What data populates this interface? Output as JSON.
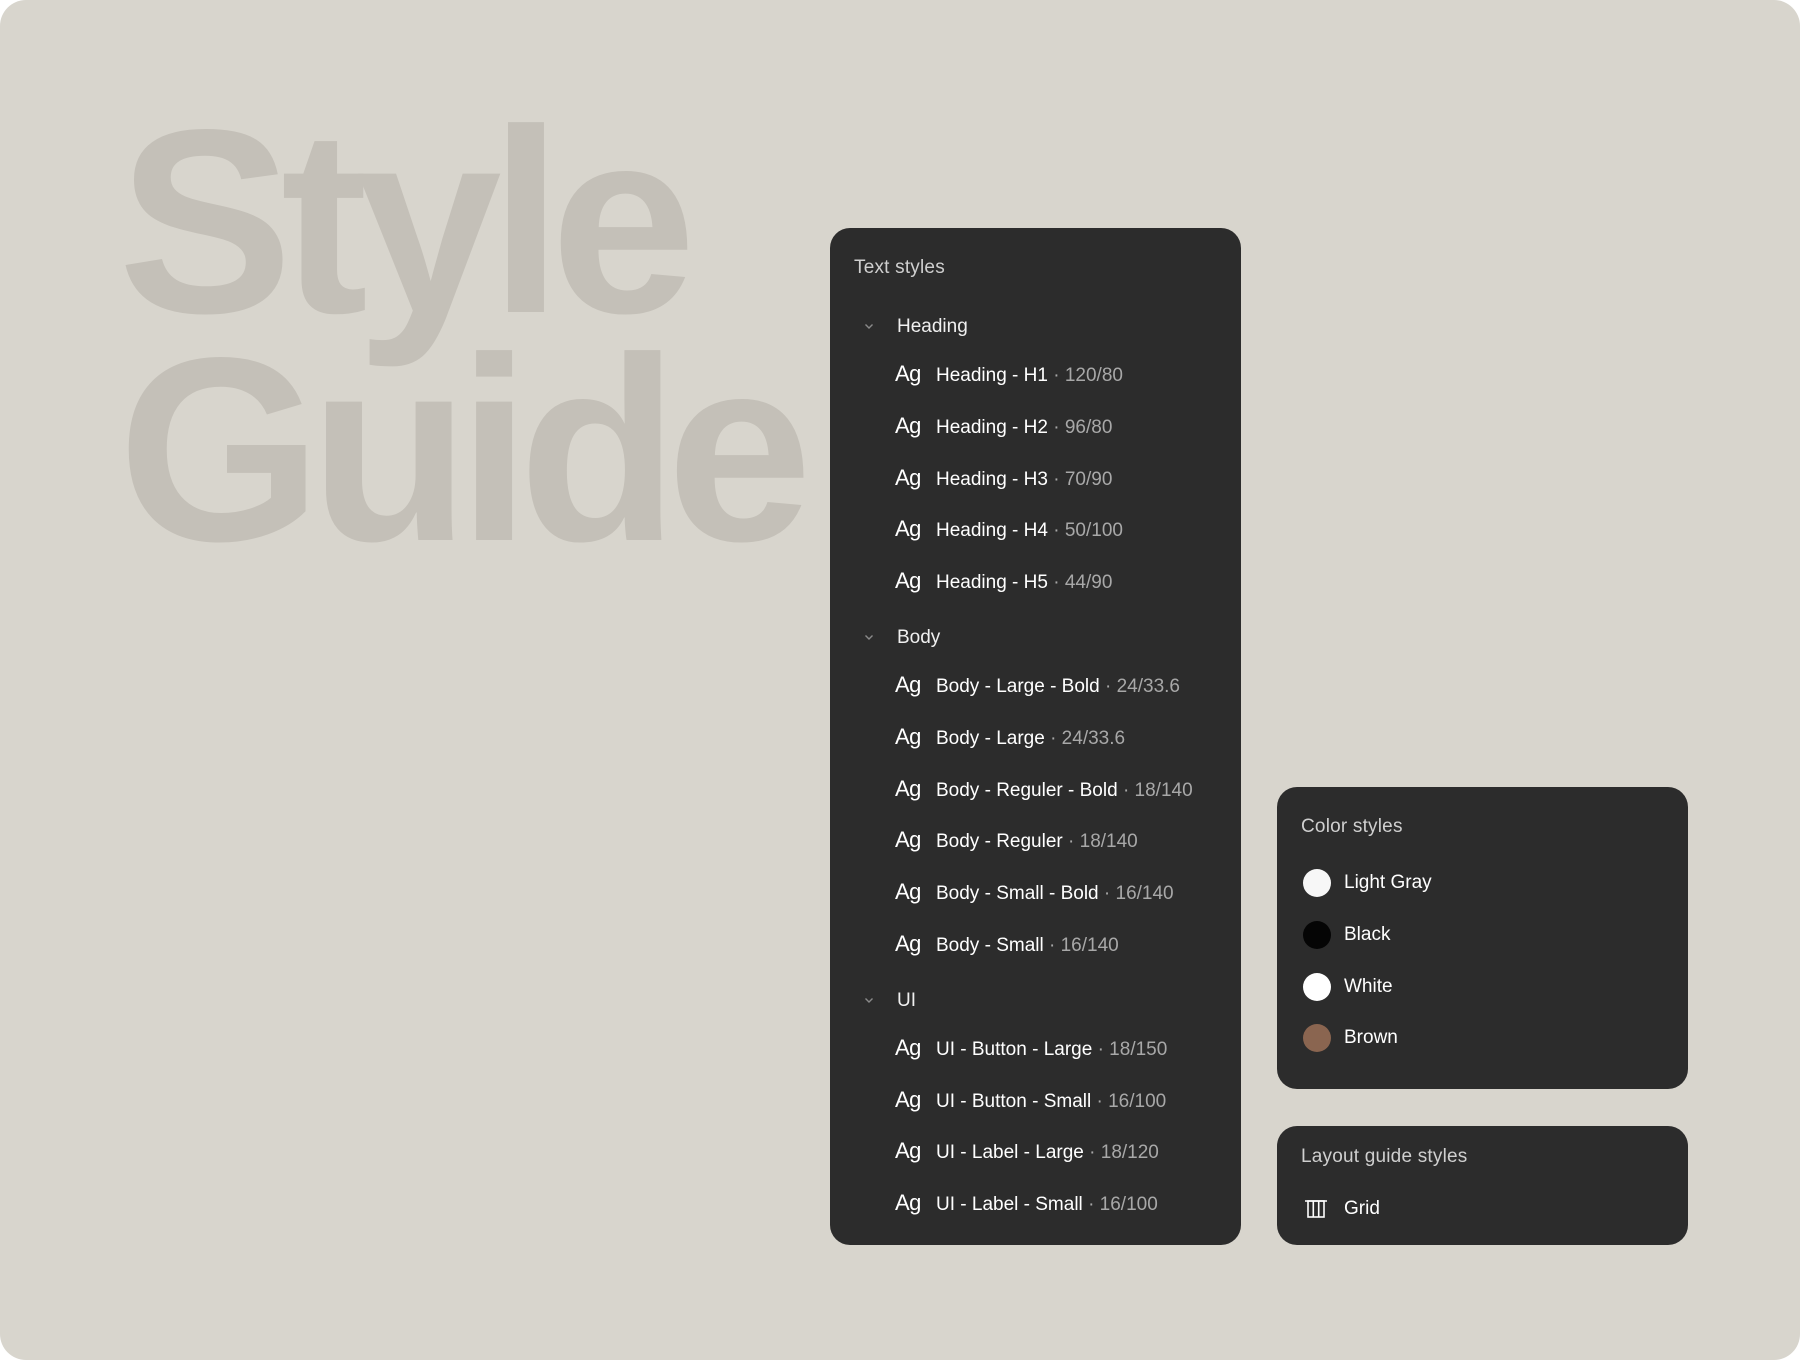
{
  "hero": {
    "line1": "Style",
    "line2": "Guide"
  },
  "text_styles": {
    "title": "Text styles",
    "groups": [
      {
        "label": "Heading",
        "styles": [
          {
            "ag": "Ag",
            "name": "Heading - H1",
            "meta": "· 120/80"
          },
          {
            "ag": "Ag",
            "name": "Heading - H2",
            "meta": "· 96/80"
          },
          {
            "ag": "Ag",
            "name": "Heading - H3",
            "meta": "· 70/90"
          },
          {
            "ag": "Ag",
            "name": "Heading - H4",
            "meta": "· 50/100"
          },
          {
            "ag": "Ag",
            "name": "Heading - H5",
            "meta": "· 44/90"
          }
        ]
      },
      {
        "label": "Body",
        "styles": [
          {
            "ag": "Ag",
            "name": "Body - Large - Bold",
            "meta": "· 24/33.6"
          },
          {
            "ag": "Ag",
            "name": "Body - Large",
            "meta": "· 24/33.6"
          },
          {
            "ag": "Ag",
            "name": "Body - Reguler - Bold",
            "meta": "· 18/140"
          },
          {
            "ag": "Ag",
            "name": "Body - Reguler",
            "meta": "· 18/140"
          },
          {
            "ag": "Ag",
            "name": "Body - Small - Bold",
            "meta": "· 16/140"
          },
          {
            "ag": "Ag",
            "name": "Body - Small",
            "meta": "· 16/140"
          }
        ]
      },
      {
        "label": "UI",
        "styles": [
          {
            "ag": "Ag",
            "name": "UI - Button - Large",
            "meta": "· 18/150"
          },
          {
            "ag": "Ag",
            "name": "UI - Button - Small",
            "meta": "· 16/100"
          },
          {
            "ag": "Ag",
            "name": "UI - Label - Large",
            "meta": "· 18/120"
          },
          {
            "ag": "Ag",
            "name": "UI - Label - Small",
            "meta": "· 16/100"
          }
        ]
      }
    ]
  },
  "color_styles": {
    "title": "Color styles",
    "items": [
      {
        "name": "Light Gray",
        "color": "#f7f7f7"
      },
      {
        "name": "Black",
        "color": "#050505"
      },
      {
        "name": "White",
        "color": "#ffffff"
      },
      {
        "name": "Brown",
        "color": "#8a6550"
      }
    ]
  },
  "layout_guides": {
    "title": "Layout guide styles",
    "items": [
      {
        "name": "Grid",
        "icon": "grid-columns-icon"
      }
    ]
  },
  "colors": {
    "canvas_bg": "#d8d5cd",
    "hero_text": "#c4c0b8",
    "panel_bg": "#2c2c2c"
  }
}
